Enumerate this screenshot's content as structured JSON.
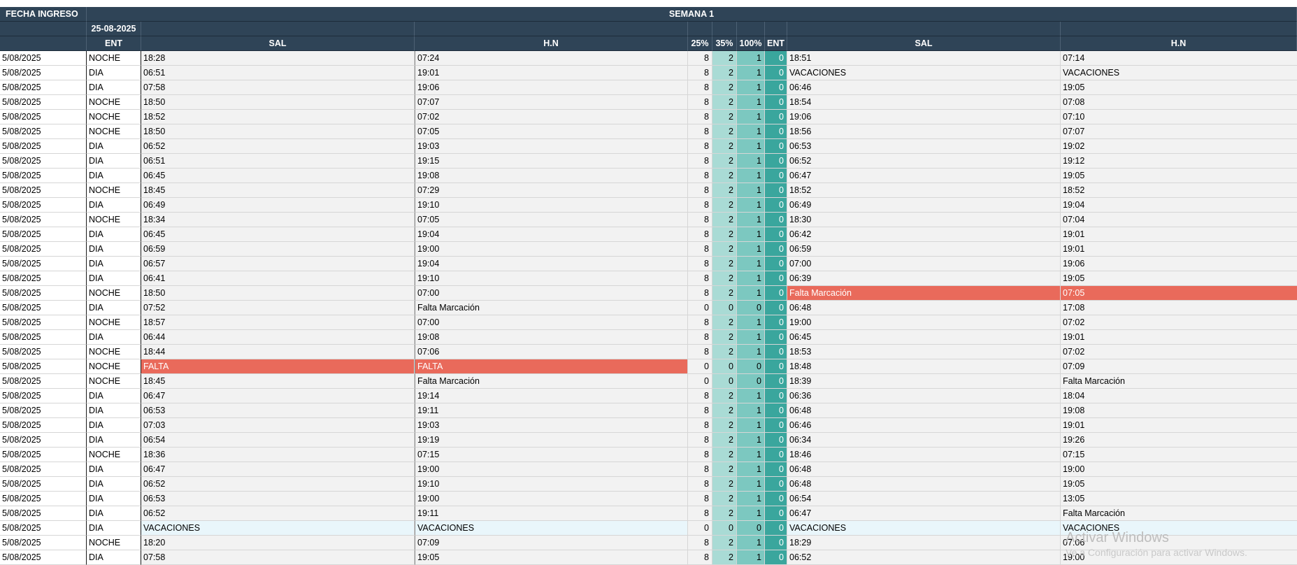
{
  "header": {
    "fecha_ingreso": "FECHA INGRESO",
    "semana": "SEMANA 1",
    "date": "25-08-2025",
    "col_ent": "ENT",
    "col_sal": "SAL",
    "col_hn": "H.N",
    "col_p25": "25%",
    "col_p35": "35%",
    "col_p100": "100%",
    "col_ent2": "ENT",
    "col_sal2": "SAL",
    "col_hn2": "H.N"
  },
  "rows": [
    {
      "fecha": "5/08/2025",
      "turno": "NOCHE",
      "ent": "18:28",
      "sal": "07:24",
      "p25": "8",
      "p35": "2",
      "p100": "1",
      "ent2": "0",
      "sal2": "18:51",
      "hn2": "07:14"
    },
    {
      "fecha": "5/08/2025",
      "turno": "DIA",
      "ent": "06:51",
      "sal": "19:01",
      "p25": "8",
      "p35": "2",
      "p100": "1",
      "ent2": "0",
      "sal2": "VACACIONES",
      "hn2": "VACACIONES"
    },
    {
      "fecha": "5/08/2025",
      "turno": "DIA",
      "ent": "07:58",
      "sal": "19:06",
      "p25": "8",
      "p35": "2",
      "p100": "1",
      "ent2": "0",
      "sal2": "06:46",
      "hn2": "19:05"
    },
    {
      "fecha": "5/08/2025",
      "turno": "NOCHE",
      "ent": "18:50",
      "sal": "07:07",
      "p25": "8",
      "p35": "2",
      "p100": "1",
      "ent2": "0",
      "sal2": "18:54",
      "hn2": "07:08"
    },
    {
      "fecha": "5/08/2025",
      "turno": "NOCHE",
      "ent": "18:52",
      "sal": "07:02",
      "p25": "8",
      "p35": "2",
      "p100": "1",
      "ent2": "0",
      "sal2": "19:06",
      "hn2": "07:10"
    },
    {
      "fecha": "5/08/2025",
      "turno": "NOCHE",
      "ent": "18:50",
      "sal": "07:05",
      "p25": "8",
      "p35": "2",
      "p100": "1",
      "ent2": "0",
      "sal2": "18:56",
      "hn2": "07:07"
    },
    {
      "fecha": "5/08/2025",
      "turno": "DIA",
      "ent": "06:52",
      "sal": "19:03",
      "p25": "8",
      "p35": "2",
      "p100": "1",
      "ent2": "0",
      "sal2": "06:53",
      "hn2": "19:02"
    },
    {
      "fecha": "5/08/2025",
      "turno": "DIA",
      "ent": "06:51",
      "sal": "19:15",
      "p25": "8",
      "p35": "2",
      "p100": "1",
      "ent2": "0",
      "sal2": "06:52",
      "hn2": "19:12"
    },
    {
      "fecha": "5/08/2025",
      "turno": "DIA",
      "ent": "06:45",
      "sal": "19:08",
      "p25": "8",
      "p35": "2",
      "p100": "1",
      "ent2": "0",
      "sal2": "06:47",
      "hn2": "19:05"
    },
    {
      "fecha": "5/08/2025",
      "turno": "NOCHE",
      "ent": "18:45",
      "sal": "07:29",
      "p25": "8",
      "p35": "2",
      "p100": "1",
      "ent2": "0",
      "sal2": "18:52",
      "hn2": "18:52"
    },
    {
      "fecha": "5/08/2025",
      "turno": "DIA",
      "ent": "06:49",
      "sal": "19:10",
      "p25": "8",
      "p35": "2",
      "p100": "1",
      "ent2": "0",
      "sal2": "06:49",
      "hn2": "19:04"
    },
    {
      "fecha": "5/08/2025",
      "turno": "NOCHE",
      "ent": "18:34",
      "sal": "07:05",
      "p25": "8",
      "p35": "2",
      "p100": "1",
      "ent2": "0",
      "sal2": "18:30",
      "hn2": "07:04"
    },
    {
      "fecha": "5/08/2025",
      "turno": "DIA",
      "ent": "06:45",
      "sal": "19:04",
      "p25": "8",
      "p35": "2",
      "p100": "1",
      "ent2": "0",
      "sal2": "06:42",
      "hn2": "19:01"
    },
    {
      "fecha": "5/08/2025",
      "turno": "DIA",
      "ent": "06:59",
      "sal": "19:00",
      "p25": "8",
      "p35": "2",
      "p100": "1",
      "ent2": "0",
      "sal2": "06:59",
      "hn2": "19:01"
    },
    {
      "fecha": "5/08/2025",
      "turno": "DIA",
      "ent": "06:57",
      "sal": "19:04",
      "p25": "8",
      "p35": "2",
      "p100": "1",
      "ent2": "0",
      "sal2": "07:00",
      "hn2": "19:06"
    },
    {
      "fecha": "5/08/2025",
      "turno": "DIA",
      "ent": "06:41",
      "sal": "19:10",
      "p25": "8",
      "p35": "2",
      "p100": "1",
      "ent2": "0",
      "sal2": "06:39",
      "hn2": "19:05"
    },
    {
      "fecha": "5/08/2025",
      "turno": "NOCHE",
      "ent": "18:50",
      "sal": "07:00",
      "p25": "8",
      "p35": "2",
      "p100": "1",
      "ent2": "0",
      "sal2": "Falta Marcación",
      "hn2": "07:05",
      "hl_right": true
    },
    {
      "fecha": "5/08/2025",
      "turno": "DIA",
      "ent": "07:52",
      "sal": "Falta Marcación",
      "p25": "0",
      "p35": "0",
      "p100": "0",
      "ent2": "0",
      "sal2": "06:48",
      "hn2": "17:08"
    },
    {
      "fecha": "5/08/2025",
      "turno": "NOCHE",
      "ent": "18:57",
      "sal": "07:00",
      "p25": "8",
      "p35": "2",
      "p100": "1",
      "ent2": "0",
      "sal2": "19:00",
      "hn2": "07:02"
    },
    {
      "fecha": "5/08/2025",
      "turno": "DIA",
      "ent": "06:44",
      "sal": "19:08",
      "p25": "8",
      "p35": "2",
      "p100": "1",
      "ent2": "0",
      "sal2": "06:45",
      "hn2": "19:01"
    },
    {
      "fecha": "5/08/2025",
      "turno": "NOCHE",
      "ent": "18:44",
      "sal": "07:06",
      "p25": "8",
      "p35": "2",
      "p100": "1",
      "ent2": "0",
      "sal2": "18:53",
      "hn2": "07:02"
    },
    {
      "fecha": "5/08/2025",
      "turno": "NOCHE",
      "ent": "FALTA",
      "sal": "FALTA",
      "p25": "0",
      "p35": "0",
      "p100": "0",
      "ent2": "0",
      "sal2": "18:48",
      "hn2": "07:09",
      "hl_left": true
    },
    {
      "fecha": "5/08/2025",
      "turno": "NOCHE",
      "ent": "18:45",
      "sal": "Falta Marcación",
      "p25": "0",
      "p35": "0",
      "p100": "0",
      "ent2": "0",
      "sal2": "18:39",
      "hn2": "Falta Marcación"
    },
    {
      "fecha": "5/08/2025",
      "turno": "DIA",
      "ent": "06:47",
      "sal": "19:14",
      "p25": "8",
      "p35": "2",
      "p100": "1",
      "ent2": "0",
      "sal2": "06:36",
      "hn2": "18:04"
    },
    {
      "fecha": "5/08/2025",
      "turno": "DIA",
      "ent": "06:53",
      "sal": "19:11",
      "p25": "8",
      "p35": "2",
      "p100": "1",
      "ent2": "0",
      "sal2": "06:48",
      "hn2": "19:08"
    },
    {
      "fecha": "5/08/2025",
      "turno": "DIA",
      "ent": "07:03",
      "sal": "19:03",
      "p25": "8",
      "p35": "2",
      "p100": "1",
      "ent2": "0",
      "sal2": "06:46",
      "hn2": "19:01"
    },
    {
      "fecha": "5/08/2025",
      "turno": "DIA",
      "ent": "06:54",
      "sal": "19:19",
      "p25": "8",
      "p35": "2",
      "p100": "1",
      "ent2": "0",
      "sal2": "06:34",
      "hn2": "19:26"
    },
    {
      "fecha": "5/08/2025",
      "turno": "NOCHE",
      "ent": "18:36",
      "sal": "07:15",
      "p25": "8",
      "p35": "2",
      "p100": "1",
      "ent2": "0",
      "sal2": "18:46",
      "hn2": "07:15"
    },
    {
      "fecha": "5/08/2025",
      "turno": "DIA",
      "ent": "06:47",
      "sal": "19:00",
      "p25": "8",
      "p35": "2",
      "p100": "1",
      "ent2": "0",
      "sal2": "06:48",
      "hn2": "19:00"
    },
    {
      "fecha": "5/08/2025",
      "turno": "DIA",
      "ent": "06:52",
      "sal": "19:10",
      "p25": "8",
      "p35": "2",
      "p100": "1",
      "ent2": "0",
      "sal2": "06:48",
      "hn2": "19:05"
    },
    {
      "fecha": "5/08/2025",
      "turno": "DIA",
      "ent": "06:53",
      "sal": "19:00",
      "p25": "8",
      "p35": "2",
      "p100": "1",
      "ent2": "0",
      "sal2": "06:54",
      "hn2": "13:05"
    },
    {
      "fecha": "5/08/2025",
      "turno": "DIA",
      "ent": "06:52",
      "sal": "19:11",
      "p25": "8",
      "p35": "2",
      "p100": "1",
      "ent2": "0",
      "sal2": "06:47",
      "hn2": "Falta Marcación"
    },
    {
      "fecha": "5/08/2025",
      "turno": "DIA",
      "ent": "VACACIONES",
      "sal": "VACACIONES",
      "p25": "0",
      "p35": "0",
      "p100": "0",
      "ent2": "0",
      "sal2": "VACACIONES",
      "hn2": "VACACIONES",
      "vac": true
    },
    {
      "fecha": "5/08/2025",
      "turno": "NOCHE",
      "ent": "18:20",
      "sal": "07:09",
      "p25": "8",
      "p35": "2",
      "p100": "1",
      "ent2": "0",
      "sal2": "18:29",
      "hn2": "07:06"
    },
    {
      "fecha": "5/08/2025",
      "turno": "DIA",
      "ent": "07:58",
      "sal": "19:05",
      "p25": "8",
      "p35": "2",
      "p100": "1",
      "ent2": "0",
      "sal2": "06:52",
      "hn2": "19:00"
    }
  ],
  "watermark": {
    "title": "Activar Windows",
    "subtitle": "Ve a Configuración para activar Windows."
  }
}
